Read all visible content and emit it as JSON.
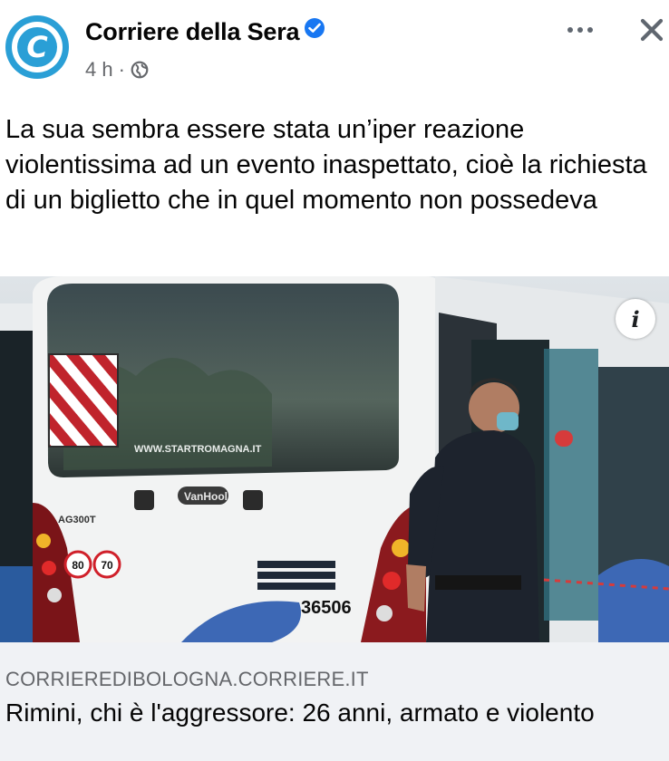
{
  "post": {
    "page_name": "Corriere della Sera",
    "time": "4 h",
    "separator": "·",
    "privacy_icon": "globe-icon",
    "avatar_letter": "C",
    "caption": "La sua sembra essere stata un’iper reazione violentissima ad un evento inaspettato, cioè la richiesta di un biglietto che in quel momento non possedeva",
    "image": {
      "bus_website": "WWW.STARTROMAGNA.IT",
      "bus_number": "36506",
      "bus_model": "AG300T",
      "speed_badges": [
        "80",
        "70"
      ],
      "brand_plate": "VanHool",
      "info_button": "i"
    },
    "link": {
      "domain": "CORRIEREDIBOLOGNA.CORRIERE.IT",
      "title": "Rimini, chi è l'aggressore: 26 anni, armato e violento"
    }
  },
  "colors": {
    "brand": "#2a9fd6",
    "verified": "#1877f2",
    "secondary_text": "#65676b",
    "link_bg": "#f0f2f5"
  }
}
